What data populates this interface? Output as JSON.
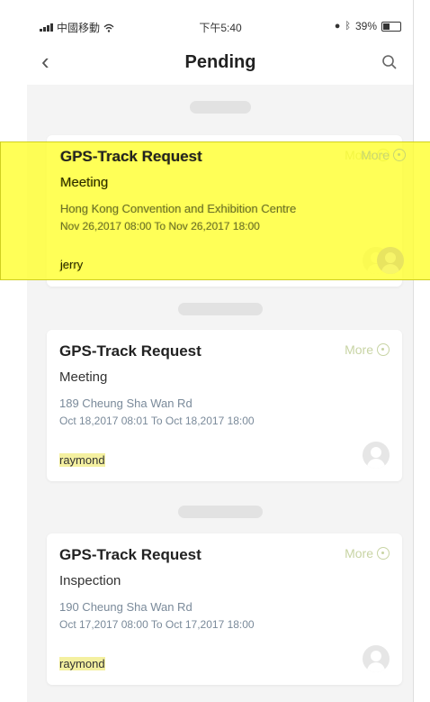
{
  "status_bar": {
    "carrier": "中國移動",
    "time": "下午5:40",
    "battery": "39%"
  },
  "nav": {
    "title": "Pending"
  },
  "date_groups": [
    "",
    "",
    ""
  ],
  "cards": [
    {
      "title": "GPS-Track Request",
      "more": "More",
      "type": "Meeting",
      "location": "Hong Kong Convention and Exhibition Centre",
      "time": "Nov 26,2017 08:00 To Nov 26,2017 18:00",
      "user": "jerry"
    },
    {
      "title": "GPS-Track Request",
      "more": "More",
      "type": "Meeting",
      "location": "189 Cheung Sha Wan Rd",
      "time": "Oct 18,2017 08:01 To Oct 18,2017 18:00",
      "user": "raymond"
    },
    {
      "title": "GPS-Track Request",
      "more": "More",
      "type": "Inspection",
      "location": "190 Cheung Sha Wan Rd",
      "time": "Oct 17,2017 08:00 To Oct 17,2017 18:00",
      "user": "raymond"
    }
  ],
  "colors": {
    "highlight": "#ffff28",
    "accent_more": "#c8d4a4",
    "meta_text": "#7a8a9a"
  }
}
